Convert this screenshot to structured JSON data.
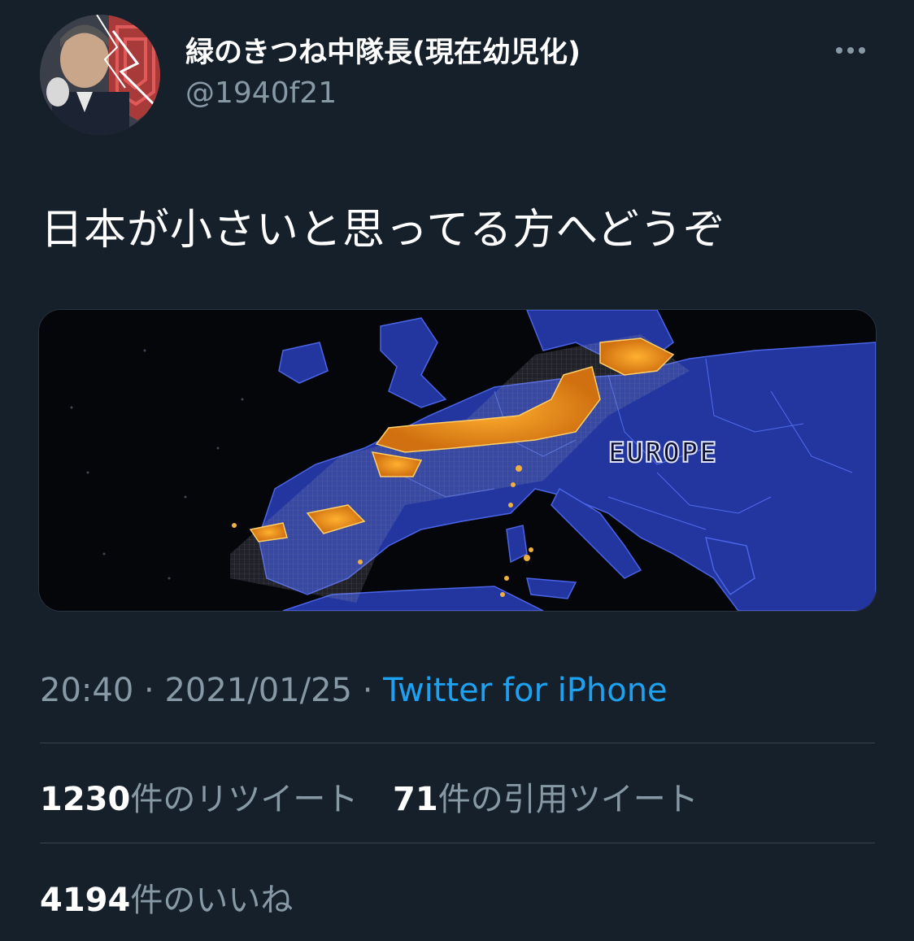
{
  "user": {
    "display_name": "緑のきつね中隊長(現在幼児化)",
    "handle": "@1940f21",
    "avatar_icon": "profile-photo"
  },
  "menu": {
    "icon": "more-horizontal-icon"
  },
  "tweet": {
    "text": "日本が小さいと思ってる方へどうぞ",
    "media": {
      "label": "EUROPE",
      "description_icon": "map-image"
    }
  },
  "meta": {
    "time": "20:40",
    "separator1": " · ",
    "date": "2021/01/25",
    "separator2": " · ",
    "source": "Twitter for iPhone"
  },
  "stats": {
    "retweets_count": "1230",
    "retweets_label": "件のリツイート",
    "quotes_count": "71",
    "quotes_label": "件の引用ツイート",
    "likes_count": "4194",
    "likes_label": "件のいいね"
  },
  "colors": {
    "background": "#15202b",
    "secondary_text": "#8899a6",
    "link": "#1da1f2",
    "divider": "#38444d",
    "map_land": "#2a3fa8",
    "japan_glow": "#f0a020"
  }
}
